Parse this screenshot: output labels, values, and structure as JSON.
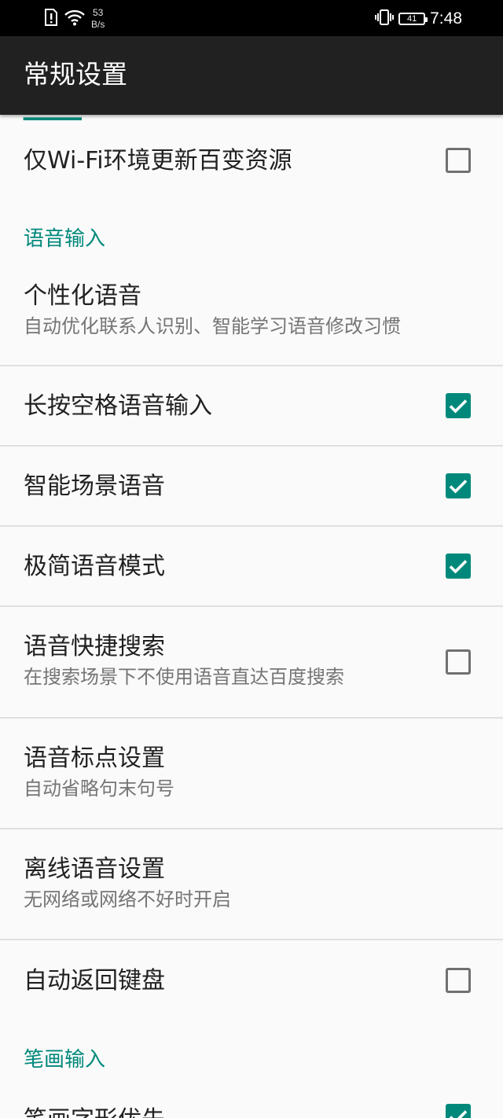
{
  "status_bar": {
    "net_speed_value": "53",
    "net_speed_unit": "B/s",
    "battery_level": "41",
    "time": "7:48"
  },
  "app_bar": {
    "title": "常规设置"
  },
  "settings": {
    "wifi_update": {
      "title": "仅Wi-Fi环境更新百变资源",
      "checked": false
    },
    "voice_section": "语音输入",
    "personal_voice": {
      "title": "个性化语音",
      "subtitle": "自动优化联系人识别、智能学习语音修改习惯"
    },
    "long_press_space": {
      "title": "长按空格语音输入",
      "checked": true
    },
    "smart_scene": {
      "title": "智能场景语音",
      "checked": true
    },
    "minimal_mode": {
      "title": "极简语音模式",
      "checked": true
    },
    "quick_search": {
      "title": "语音快捷搜索",
      "subtitle": "在搜索场景下不使用语音直达百度搜索",
      "checked": false
    },
    "punctuation": {
      "title": "语音标点设置",
      "subtitle": "自动省略句末句号"
    },
    "offline_voice": {
      "title": "离线语音设置",
      "subtitle": "无网络或网络不好时开启"
    },
    "auto_return": {
      "title": "自动返回键盘",
      "checked": false
    },
    "stroke_section": "笔画输入",
    "stroke_priority": {
      "title": "笔画字形优先",
      "checked": true
    }
  },
  "colors": {
    "accent": "#00897b",
    "app_bar": "#212121",
    "background": "#fafafa"
  }
}
